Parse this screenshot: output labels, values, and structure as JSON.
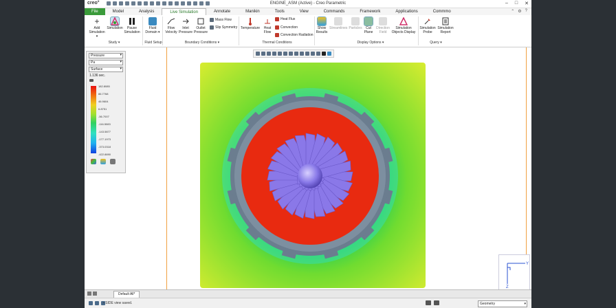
{
  "app": {
    "logo": "creo°",
    "window_title": "ENGINE_ASM (Active) - Creo Parametric",
    "window_controls": [
      "–",
      "□",
      "✕"
    ]
  },
  "tabs": [
    {
      "label": "File"
    },
    {
      "label": "Model"
    },
    {
      "label": "Analysis"
    },
    {
      "label": "Live Simulation"
    },
    {
      "label": "Annotate"
    },
    {
      "label": "Manikin"
    },
    {
      "label": "Tools"
    },
    {
      "label": "View"
    },
    {
      "label": "Commands"
    },
    {
      "label": "Framework"
    },
    {
      "label": "Applications"
    },
    {
      "label": "Commmo"
    }
  ],
  "ribbon": {
    "add_simulation": "Add Simulation ▾",
    "simulation": "Simulation",
    "pause_simulation": "Pause Simulation",
    "fluid_domain": "Fluid Domain ▾",
    "flow_velocity": "Flow Velocity",
    "inlet_pressure": "Inlet Pressure",
    "outlet_pressure": "Outlet Pressure",
    "mass_flow": "Mass Flow",
    "slip_symmetry": "Slip Symmetry",
    "temperature": "Temperature",
    "heat_flow": "Heat Flow",
    "heat_flux": "Heat Flux",
    "convection": "Convection",
    "convection_radiation": "Convection Radiation",
    "show_results": "Show Results",
    "streamlines": "Streamlines",
    "particles": "Particles",
    "cut_plane": "Cut Plane",
    "direction_field": "Direction Field",
    "simulation_objects_display": "Simulation Objects Display",
    "simulation_probe": "Simulation Probe",
    "simulation_report": "Simulation Report",
    "groups": {
      "study": "Study ▾",
      "fluid_setup": "Fluid Setup",
      "boundary_conditions": "Boundary Conditions ▾",
      "thermal_conditions": "Thermal Conditions",
      "display_options": "Display Options ▾",
      "query": "Query ▾"
    }
  },
  "legend_panel": {
    "quantity": "Pressure",
    "unit": "Pa",
    "display": "Surface",
    "time": "1.136 sec.",
    "values": [
      "182.8085",
      "86.7768",
      "46.9604",
      "6.8751",
      "-56.7007",
      "-116.5083",
      "-143.5877",
      "-177.1973",
      "-373.0318",
      "-422.8890"
    ]
  },
  "bottom": {
    "layer_tab": "Default All*",
    "status_message": "• SIDE view saved.",
    "filter": "Geometry"
  },
  "colors": {
    "file_tab": "#3a9a3a",
    "accent": "#2a7a2a",
    "blades": "#8a78e8",
    "gap": "#e82a10",
    "ring": "#6b7d8f"
  }
}
